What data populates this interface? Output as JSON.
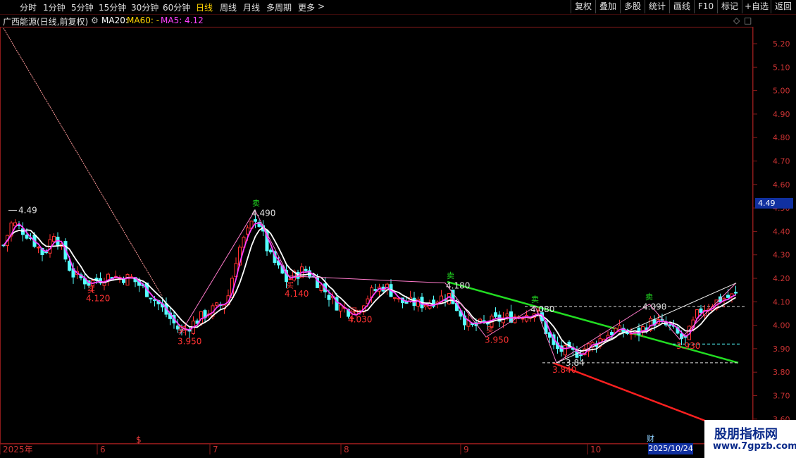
{
  "toolbar": {
    "periods": [
      "分时",
      "1分钟",
      "5分钟",
      "15分钟",
      "30分钟",
      "60分钟",
      "日线",
      "周线",
      "月线",
      "多周期",
      "更多"
    ],
    "more_arrow": ">",
    "buttons": [
      "复权",
      "叠加",
      "多股",
      "统计",
      "画线",
      "F10",
      "标记",
      "+自选",
      "返回"
    ]
  },
  "info": {
    "title": "广西能源(日线,前复权)",
    "ma20_label": "MA20:",
    "ma60_label": "MA60: -",
    "ma5_label": "MA5: 4.12",
    "icons": [
      "◇",
      "□"
    ]
  },
  "colors": {
    "up": "#ff3232",
    "down": "#54ffff",
    "ma5": "#ff40ff",
    "ma20": "#ffffff",
    "axis": "#8b1a1a",
    "price_text": "#c83232",
    "green_line": "#22dd22",
    "red_line": "#ff2020"
  },
  "price_axis": {
    "ticks": [
      "5.20",
      "5.10",
      "5.00",
      "4.90",
      "4.80",
      "4.70",
      "4.60",
      "4.50",
      "4.40",
      "4.30",
      "4.20",
      "4.10",
      "4.00",
      "3.90",
      "3.80",
      "3.70",
      "3.60"
    ],
    "current": "4.49"
  },
  "time_axis": {
    "labels": [
      "2025年",
      "6",
      "7",
      "8",
      "9",
      "10"
    ],
    "marker_s": "$",
    "marker_cai": "财",
    "date_badge": "2025/10/24"
  },
  "annotations": {
    "high1": "4.49",
    "high2": "4.490",
    "high3": "4.180",
    "high4": "4.080",
    "high5": "4.090",
    "low1": "4.120",
    "low2": "3.950",
    "low3": "4.140",
    "low4": "4.030",
    "low5": "3.950",
    "low6": "3.840",
    "low6b": "3.84",
    "low7": "3.930",
    "buy": "买",
    "sell": "卖"
  },
  "chart_data": {
    "type": "candlestick",
    "title": "广西能源(日线,前复权)",
    "ylim": [
      3.57,
      5.27
    ],
    "indicators": [
      {
        "name": "MA5",
        "value": 4.12
      },
      {
        "name": "MA20",
        "value": null
      },
      {
        "name": "MA60",
        "value": null
      }
    ],
    "swing_points": [
      4.49,
      4.12,
      3.95,
      4.49,
      4.14,
      4.03,
      4.18,
      3.95,
      4.08,
      3.84,
      4.09,
      3.93
    ]
  },
  "watermark": {
    "line1": "股朋指标网",
    "line2": "www.7gpzb.com"
  }
}
